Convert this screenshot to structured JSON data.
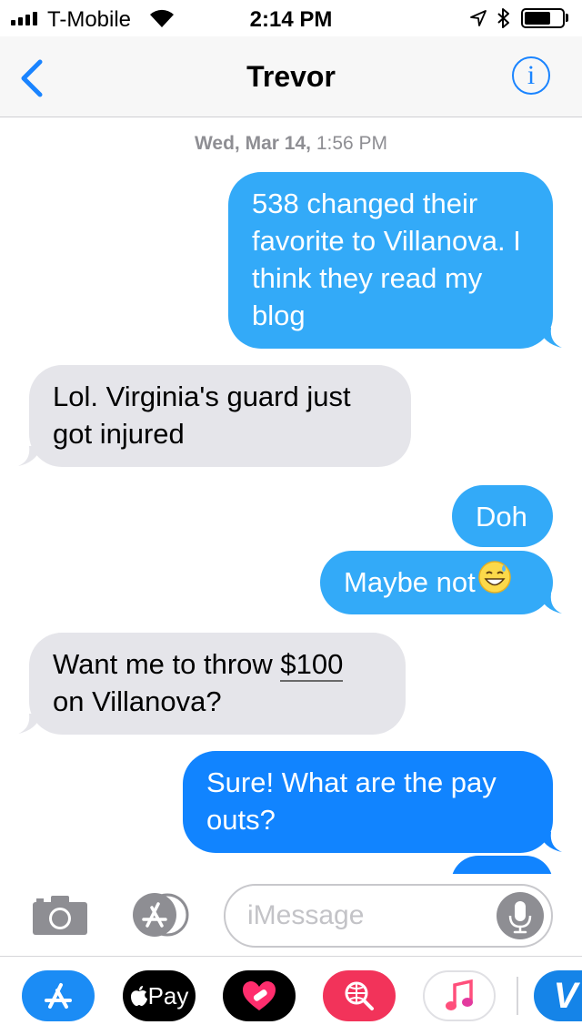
{
  "status_bar": {
    "carrier": "T-Mobile",
    "time": "2:14 PM",
    "battery_level": 0.6
  },
  "nav": {
    "title": "Trevor",
    "info_glyph": "i"
  },
  "conversation": {
    "timestamp_day": "Wed, Mar 14,",
    "timestamp_time": "1:56 PM",
    "messages": [
      {
        "from": "me",
        "text": "538 changed their favorite to Villanova. I think they read my blog"
      },
      {
        "from": "them",
        "text": "Lol. Virginia's guard just got injured"
      },
      {
        "from": "me",
        "text": "Doh"
      },
      {
        "from": "me",
        "text": "Maybe not",
        "emoji": "grinning-sweat-emoji"
      },
      {
        "from": "them",
        "text_before": "Want me to throw ",
        "link": "$100",
        "text_after": " on Villanova?"
      },
      {
        "from": "me",
        "text": "Sure! What are the pay outs?"
      }
    ]
  },
  "composer": {
    "placeholder": "iMessage"
  },
  "app_drawer": {
    "apple_pay_label": "Pay",
    "partial_app_letter": "V"
  },
  "colors": {
    "ios_blue": "#1184ff",
    "sent_light_blue": "#33aaf8",
    "received_gray": "#e5e5ea",
    "timestamp_gray": "#8e8e93"
  }
}
